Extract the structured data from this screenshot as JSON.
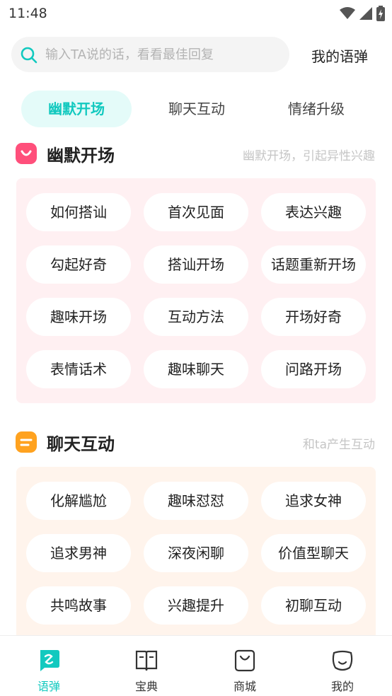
{
  "status_bar": {
    "time": "11:48"
  },
  "search": {
    "placeholder": "输入TA说的话，看看最佳回复",
    "value": ""
  },
  "header": {
    "my_bullets": "我的语弹"
  },
  "tabs": [
    {
      "label": "幽默开场",
      "active": true
    },
    {
      "label": "聊天互动",
      "active": false
    },
    {
      "label": "情绪升级",
      "active": false
    }
  ],
  "sections": [
    {
      "title": "幽默开场",
      "subtitle": "幽默开场，引起异性兴趣",
      "accent": "#ff4f7b",
      "chips": [
        "如何搭讪",
        "首次见面",
        "表达兴趣",
        "勾起好奇",
        "搭讪开场",
        "话题重新开场",
        "趣味开场",
        "互动方法",
        "开场好奇",
        "表情话术",
        "趣味聊天",
        "问路开场"
      ]
    },
    {
      "title": "聊天互动",
      "subtitle": "和ta产生互动",
      "accent": "#ffa21f",
      "chips": [
        "化解尴尬",
        "趣味怼怼",
        "追求女神",
        "追求男神",
        "深夜闲聊",
        "价值型聊天",
        "共鸣故事",
        "兴趣提升",
        "初聊互动"
      ]
    }
  ],
  "bottom_nav": [
    {
      "label": "语弹",
      "icon": "chat-bubble-icon",
      "active": true
    },
    {
      "label": "宝典",
      "icon": "book-icon",
      "active": false
    },
    {
      "label": "商城",
      "icon": "shopping-bag-icon",
      "active": false
    },
    {
      "label": "我的",
      "icon": "smiley-face-icon",
      "active": false
    }
  ],
  "colors": {
    "accent": "#12c9bf",
    "tab_active_bg": "#e4fbf9",
    "panel_pink": "#fff0f2",
    "panel_peach": "#fff4ec"
  }
}
